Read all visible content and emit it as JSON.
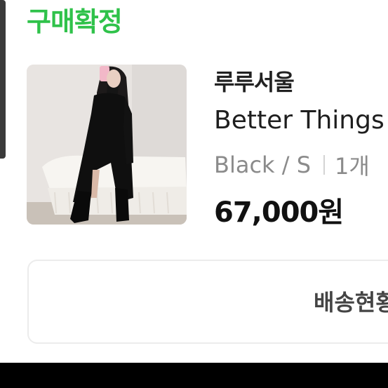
{
  "order": {
    "status": "구매확정",
    "status_color": "#2fc24a"
  },
  "product": {
    "seller": "루루서울",
    "name": "Better Things",
    "option": "Black / S",
    "quantity": "1개",
    "price": "67,000원",
    "image_icon": "product-photo"
  },
  "actions": {
    "delivery_status_label": "배송현황"
  }
}
